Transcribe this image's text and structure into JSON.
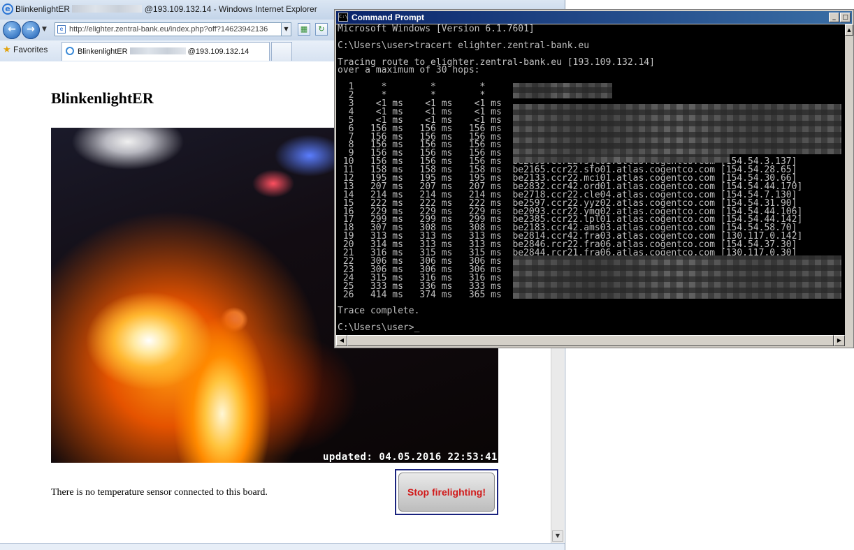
{
  "ie": {
    "title_prefix": "BlinkenlightER",
    "title_suffix": "@193.109.132.14 - Windows Internet Explorer",
    "address": "http://elighter.zentral-bank.eu/index.php?off?14623942136",
    "favorites_label": "Favorites",
    "tab_prefix": "BlinkenlightER",
    "tab_suffix": "@193.109.132.14",
    "icons": {
      "back": "back-arrow-icon",
      "forward": "forward-arrow-icon",
      "refresh": "refresh-icon",
      "go": "go-arrow-icon",
      "star": "star-icon"
    }
  },
  "page": {
    "heading": "BlinkenlightER",
    "cam_timestamp": "updated: 04.05.2016 22:53:41",
    "temp_text": "There is no temperature sensor connected to this board.",
    "stop_button": "Stop firelighting!",
    "stop_color": "#d11a1a"
  },
  "cmd": {
    "title": "Command Prompt",
    "lines": [
      "Microsoft Windows [Version 6.1.7601]",
      "",
      "C:\\Users\\user>tracert elighter.zentral-bank.eu",
      "",
      "Tracing route to elighter.zentral-bank.eu [193.109.132.14]",
      "over a maximum of 30 hops:",
      "",
      "  1     *        *        *",
      "  2     *        *        *",
      "  3    <1 ms    <1 ms    <1 ms",
      "  4    <1 ms    <1 ms    <1 ms",
      "  5    <1 ms    <1 ms    <1 ms",
      "  6   156 ms   156 ms   156 ms",
      "  7   156 ms   156 ms   156 ms",
      "  8   156 ms   156 ms   156 ms",
      "  9   156 ms   156 ms   156 ms",
      " 10   156 ms   156 ms   156 ms  be2095.ccr22.sjc01.atlas.cogentco.com [154.54.3.137]",
      " 11   158 ms   158 ms   158 ms  be2165.ccr22.sfo01.atlas.cogentco.com [154.54.28.65]",
      " 12   195 ms   195 ms   195 ms  be2133.ccr22.mci01.atlas.cogentco.com [154.54.30.66]",
      " 13   207 ms   207 ms   207 ms  be2832.ccr42.ord01.atlas.cogentco.com [154.54.44.170]",
      " 14   214 ms   214 ms   214 ms  be2718.ccr22.cle04.atlas.cogentco.com [154.54.7.130]",
      " 15   222 ms   222 ms   222 ms  be2597.ccr22.yyz02.atlas.cogentco.com [154.54.31.90]",
      " 16   229 ms   229 ms   229 ms  be2093.ccr22.ymq02.atlas.cogentco.com [154.54.44.106]",
      " 17   299 ms   299 ms   299 ms  be2385.ccr22.lpl01.atlas.cogentco.com [154.54.44.142]",
      " 18   307 ms   308 ms   308 ms  be2183.ccr42.ams03.atlas.cogentco.com [154.54.58.70]",
      " 19   313 ms   313 ms   313 ms  be2814.ccr42.fra03.atlas.cogentco.com [130.117.0.142]",
      " 20   314 ms   313 ms   313 ms  be2846.rcr22.fra06.atlas.cogentco.com [154.54.37.30]",
      " 21   316 ms   315 ms   315 ms  be2844.rcr21.fra06.atlas.cogentco.com [130.117.0.30]",
      " 22   306 ms   306 ms   306 ms",
      " 23   306 ms   306 ms   306 ms",
      " 24   315 ms   316 ms   316 ms",
      " 25   333 ms   336 ms   333 ms",
      " 26   414 ms   374 ms   365 ms",
      "",
      "Trace complete.",
      "",
      "C:\\Users\\user>_"
    ]
  }
}
